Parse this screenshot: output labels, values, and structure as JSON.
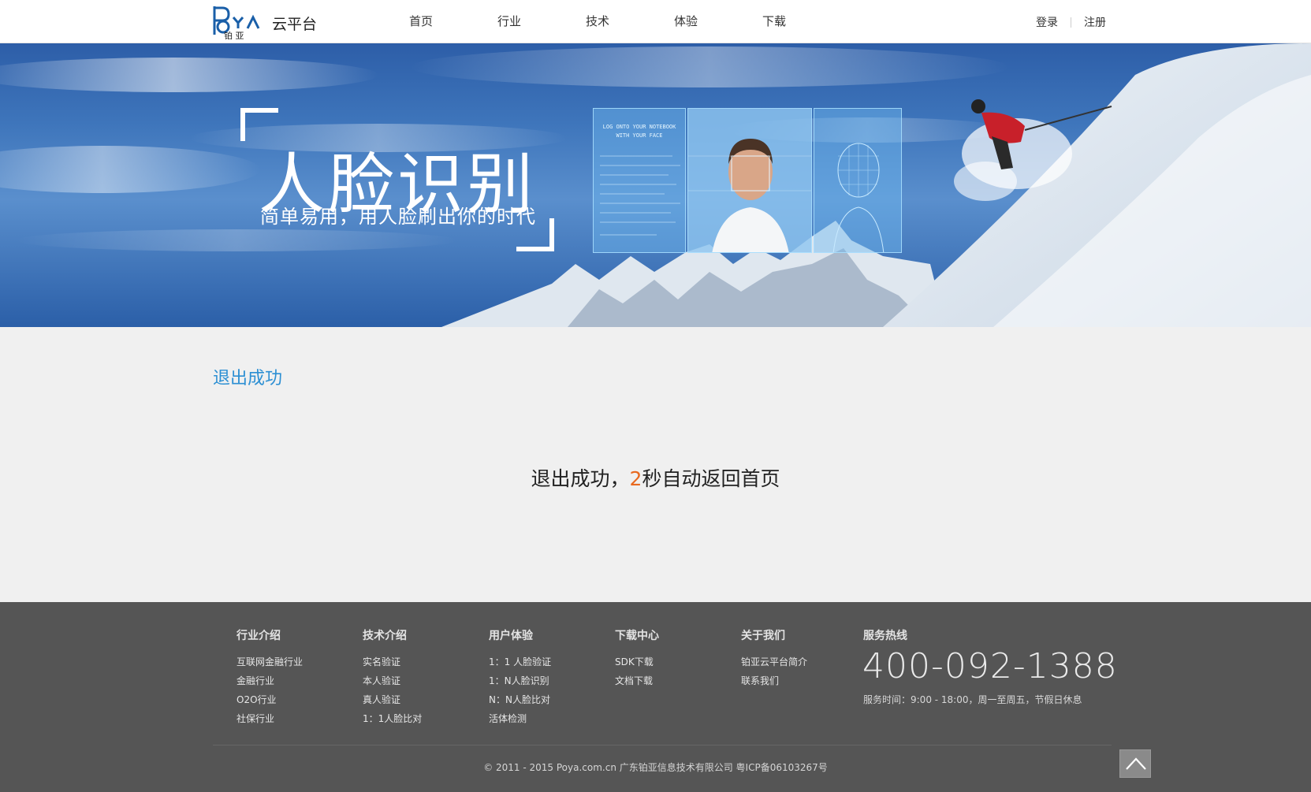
{
  "header": {
    "logo_text": "POYA",
    "logo_sub": "铂 亚",
    "brand": "云平台",
    "nav": [
      "首页",
      "行业",
      "技术",
      "体验",
      "下载"
    ],
    "login": "登录",
    "register": "注册"
  },
  "banner": {
    "title": "人脸识别",
    "subtitle": "简单易用，用人脸刷出你的时代",
    "screen_text_1": "LOG ONTO YOUR NOTEBOOK",
    "screen_text_2": "WITH YOUR FACE"
  },
  "main": {
    "page_title": "退出成功",
    "message_prefix": "退出成功，",
    "countdown": "2",
    "message_suffix": "秒自动返回首页"
  },
  "footer": {
    "columns": [
      {
        "title": "行业介绍",
        "links": [
          "互联网金融行业",
          "金融行业",
          "O2O行业",
          "社保行业"
        ]
      },
      {
        "title": "技术介绍",
        "links": [
          "实名验证",
          "本人验证",
          "真人验证",
          "1：1人脸比对"
        ]
      },
      {
        "title": "用户体验",
        "links": [
          "1：1 人脸验证",
          "1：N人脸识别",
          "N：N人脸比对",
          "活体检测"
        ]
      },
      {
        "title": "下载中心",
        "links": [
          "SDK下载",
          "文档下载"
        ]
      },
      {
        "title": "关于我们",
        "links": [
          "铂亚云平台简介",
          "联系我们"
        ]
      }
    ],
    "hotline_title": "服务热线",
    "hotline_number": "400-092-1388",
    "hotline_hours": "服务时间：9:00 - 18:00，周一至周五，节假日休息",
    "copyright": "© 2011 - 2015 Poya.com.cn 广东铂亚信息技术有限公司 粤ICP备06103267号"
  },
  "colors": {
    "accent": "#2c8fd3",
    "countdown": "#e8691f",
    "footer_bg": "#555555",
    "page_bg": "#f0f0f0"
  },
  "icons": [
    "poya-logo",
    "back-to-top-arrow-icon"
  ]
}
